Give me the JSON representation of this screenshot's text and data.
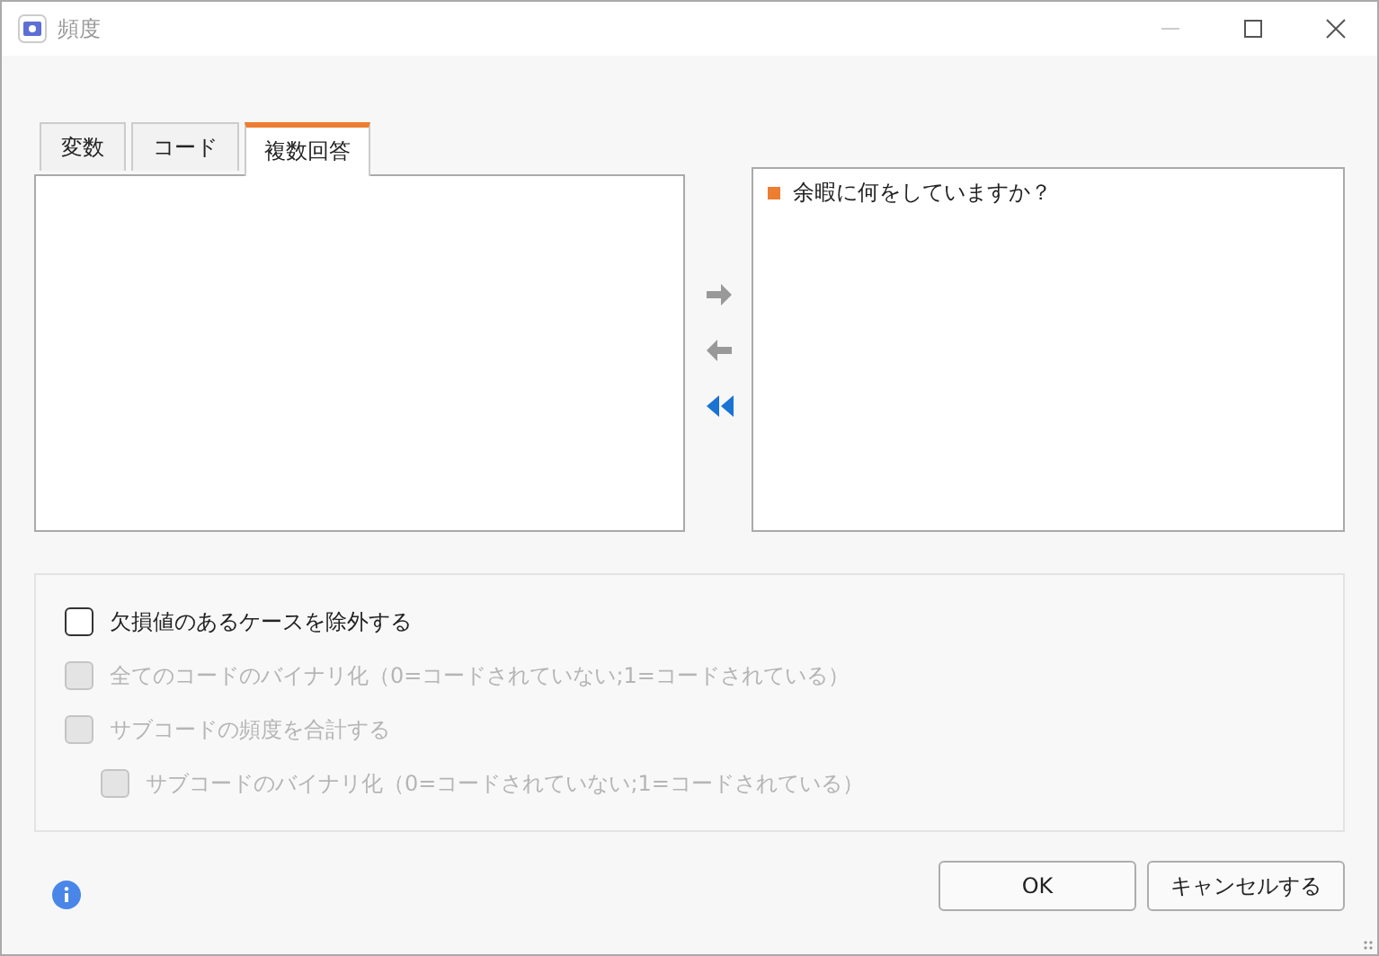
{
  "window": {
    "title": "頻度"
  },
  "tabs": [
    {
      "label": "変数",
      "selected": false
    },
    {
      "label": "コード",
      "selected": false
    },
    {
      "label": "複数回答",
      "selected": true
    }
  ],
  "transfer_buttons": [
    {
      "kind": "right",
      "disabled": true
    },
    {
      "kind": "left",
      "disabled": true
    },
    {
      "kind": "all_left",
      "disabled": false
    }
  ],
  "selected_list": {
    "items": [
      {
        "label": "余暇に何をしていますか？",
        "color": "#ed7d31"
      }
    ]
  },
  "options": [
    {
      "label": "欠損値のあるケースを除外する",
      "checked": false,
      "disabled": false
    },
    {
      "label": "全てのコードのバイナリ化（0=コードされていない;1=コードされている）",
      "checked": false,
      "disabled": true
    },
    {
      "label": "サブコードの頻度を合計する",
      "checked": false,
      "disabled": true,
      "children": [
        {
          "label": "サブコードのバイナリ化（0=コードされていない;1=コードされている）",
          "checked": false,
          "disabled": true
        }
      ]
    }
  ],
  "buttons": [
    "OK",
    "キャンセルする"
  ]
}
